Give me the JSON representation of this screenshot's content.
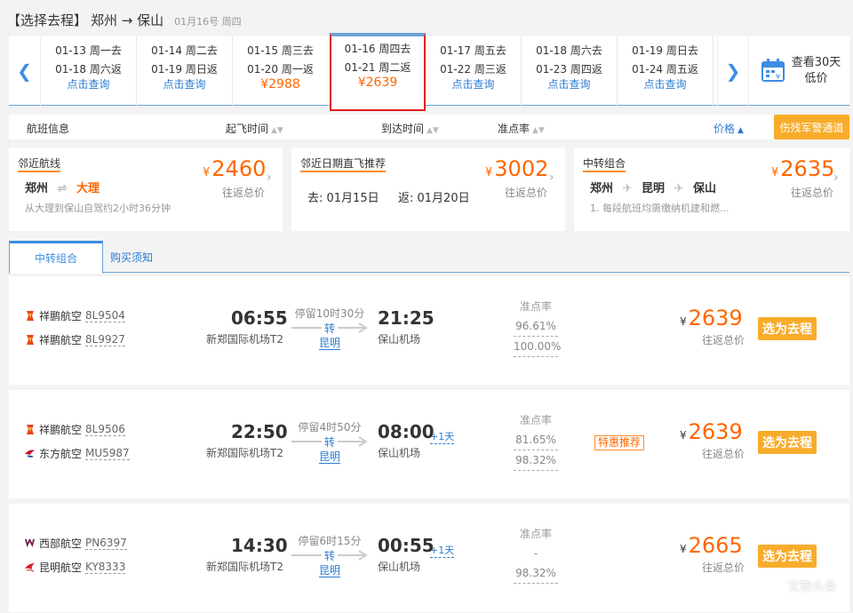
{
  "header": {
    "select_label": "【选择去程】",
    "route": "郑州 → 保山",
    "date": "01月16号 周四"
  },
  "date_strip": {
    "cells": [
      {
        "go": "01-13 周一去",
        "back": "01-18 周六返",
        "action": "点击查询",
        "price": ""
      },
      {
        "go": "01-14 周二去",
        "back": "01-19 周日返",
        "action": "点击查询",
        "price": ""
      },
      {
        "go": "01-15 周三去",
        "back": "01-20 周一返",
        "action": "",
        "price": "¥2988"
      },
      {
        "go": "01-16 周四去",
        "back": "01-21 周二返",
        "action": "",
        "price": "¥2639"
      },
      {
        "go": "01-17 周五去",
        "back": "01-22 周三返",
        "action": "点击查询",
        "price": ""
      },
      {
        "go": "01-18 周六去",
        "back": "01-23 周四返",
        "action": "点击查询",
        "price": ""
      },
      {
        "go": "01-19 周日去",
        "back": "01-24 周五返",
        "action": "点击查询",
        "price": ""
      }
    ],
    "calendar_line1": "查看30天",
    "calendar_line2": "低价"
  },
  "sort_bar": {
    "flight_info": "航班信息",
    "depart_time": "起飞时间",
    "arrive_time": "到达时间",
    "ontime_rate": "准点率",
    "price": "价格",
    "military_btn": "伤残军警通道"
  },
  "recs": [
    {
      "title": "邻近航线",
      "price": "2460",
      "price_sub": "往返总价",
      "from": "郑州",
      "to": "大理",
      "note": "从大理到保山自驾约2小时36分钟"
    },
    {
      "title": "邻近日期直飞推荐",
      "price": "3002",
      "price_sub": "往返总价",
      "go": "去: 01月15日",
      "back": "返: 01月20日"
    },
    {
      "title": "中转组合",
      "price": "2635",
      "price_sub": "往返总价",
      "c1": "郑州",
      "c2": "昆明",
      "c3": "保山",
      "note": "1. 每段航班均需缴纳机建和燃..."
    }
  ],
  "tabs": {
    "active": "中转组合",
    "other": "购买须知"
  },
  "flights": [
    {
      "legs": [
        {
          "airline": "祥鹏航空",
          "no": "8L9504",
          "logo": "xiangpeng-logo-icon"
        },
        {
          "airline": "祥鹏航空",
          "no": "8L9927",
          "logo": "xiangpeng-logo-icon"
        }
      ],
      "dep_time": "06:55",
      "dep_airport": "新郑国际机场T2",
      "stop": "停留10时30分",
      "transfer": "转",
      "transfer_city": "昆明",
      "arr_time": "21:25",
      "arr_airport": "保山机场",
      "plus_day": "",
      "ontime_title": "准点率",
      "ontime1": "96.61%",
      "ontime2": "100.00%",
      "badge": "",
      "price": "2639",
      "price_sub": "往返总价",
      "btn": "选为去程"
    },
    {
      "legs": [
        {
          "airline": "祥鹏航空",
          "no": "8L9506",
          "logo": "xiangpeng-logo-icon"
        },
        {
          "airline": "东方航空",
          "no": "MU5987",
          "logo": "china-eastern-logo-icon"
        }
      ],
      "dep_time": "22:50",
      "dep_airport": "新郑国际机场T2",
      "stop": "停留4时50分",
      "transfer": "转",
      "transfer_city": "昆明",
      "arr_time": "08:00",
      "arr_airport": "保山机场",
      "plus_day": "+1天",
      "ontime_title": "准点率",
      "ontime1": "81.65%",
      "ontime2": "98.32%",
      "badge": "特惠推荐",
      "price": "2639",
      "price_sub": "往返总价",
      "btn": "选为去程"
    },
    {
      "legs": [
        {
          "airline": "西部航空",
          "no": "PN6397",
          "logo": "west-air-logo-icon"
        },
        {
          "airline": "昆明航空",
          "no": "KY8333",
          "logo": "kunming-air-logo-icon"
        }
      ],
      "dep_time": "14:30",
      "dep_airport": "新郑国际机场T2",
      "stop": "停留6时15分",
      "transfer": "转",
      "transfer_city": "昆明",
      "arr_time": "00:55",
      "arr_airport": "保山机场",
      "plus_day": "+1天",
      "ontime_title": "准点率",
      "ontime1": "-",
      "ontime2": "98.32%",
      "badge": "",
      "price": "2665",
      "price_sub": "往返总价",
      "btn": "选为去程"
    }
  ],
  "watermark": "文旅头条",
  "colors": {
    "accent": "#ff6600",
    "link": "#2b7bd1",
    "button": "#f8ac2b",
    "active_border": "#e02020"
  }
}
